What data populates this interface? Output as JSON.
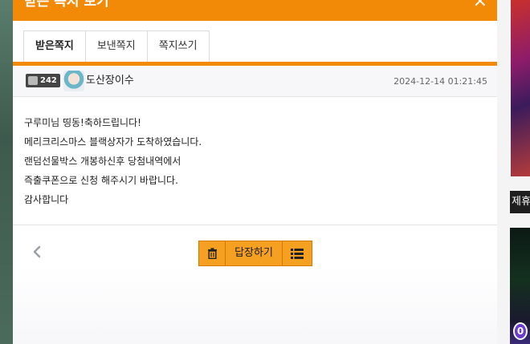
{
  "modal": {
    "title": "받은 쪽지 보기",
    "close_icon": "×"
  },
  "tabs": [
    {
      "label": "받은쪽지",
      "active": true
    },
    {
      "label": "보낸쪽지",
      "active": false
    },
    {
      "label": "쪽지쓰기",
      "active": false
    }
  ],
  "sender": {
    "level": "242",
    "name": "도산장이수",
    "date": "2024-12-14 01:21:45"
  },
  "message": {
    "lines": [
      "구루미님 띵동!축하드립니다!",
      "메리크리스마스 블랙상자가 도착하였습니다.",
      "랜덤선물박스 개봉하신후 당첨내역에서",
      "즉출쿠폰으로 신청 해주시기 바랍니다.",
      "감사합니다"
    ]
  },
  "actions": {
    "delete_icon": "trash-icon",
    "reply_label": "답장하기",
    "list_icon": "list-icon",
    "prev_icon": "chevron-left-icon"
  },
  "background": {
    "side_text": "제휴",
    "badge_text": "0"
  },
  "colors": {
    "accent": "#f28a08",
    "button": "#f5a020"
  }
}
